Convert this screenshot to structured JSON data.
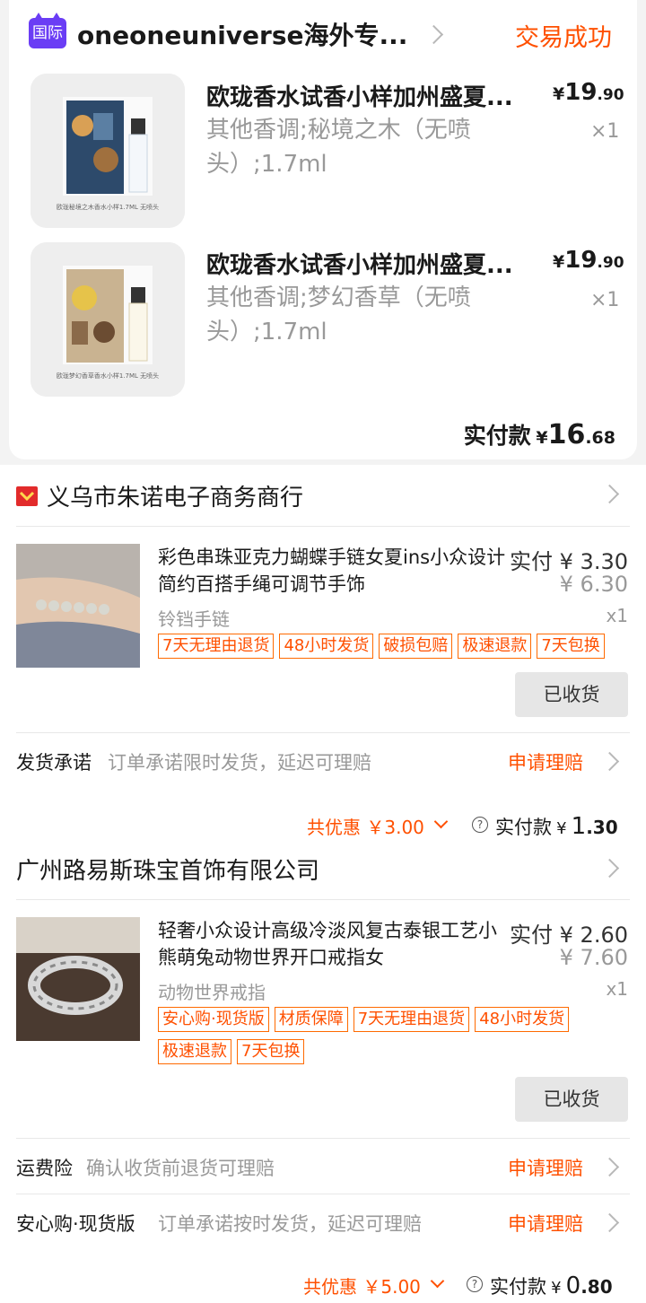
{
  "shop1": {
    "badge": "国际",
    "name": "oneoneuniverse海外专...",
    "status": "交易成功",
    "items": [
      {
        "title": "欧珑香水试香小样加州盛夏...",
        "sku": "其他香调;秘境之木（无喷头）;1.7ml",
        "price_int": "19",
        "price_dec": ".90",
        "currency": "¥",
        "qty": "×1",
        "caption": "欧珑秘境之木香水小样1.7ML 无喷头"
      },
      {
        "title": "欧珑香水试香小样加州盛夏...",
        "sku": "其他香调;梦幻香草（无喷头）;1.7ml",
        "price_int": "19",
        "price_dec": ".90",
        "currency": "¥",
        "qty": "×1",
        "caption": "欧珑梦幻香草香水小样1.7ML 无喷头"
      }
    ],
    "paid_label": "实付款",
    "paid_currency": "¥",
    "paid_int": "16",
    "paid_dec": ".68"
  },
  "shop2": {
    "name": "义乌市朱诺电子商务商行",
    "item": {
      "title": "彩色串珠亚克力蝴蝶手链女夏ins小众设计简约百搭手绳可调节手饰",
      "paid_label": "实付",
      "paid_price": "¥ 3.30",
      "orig_price": "¥ 6.30",
      "sku": "铃铛手链",
      "qty": "x1",
      "tags": [
        "7天无理由退货",
        "48小时发货",
        "破损包赔",
        "极速退款",
        "7天包换"
      ]
    },
    "button": "已收货",
    "service_label": "发货承诺",
    "service_desc": "订单承诺限时发货，延迟可理赔",
    "claim": "申请理赔",
    "discount": "共优惠 ￥3.00",
    "question": "?",
    "total_label": "实付款",
    "total_currency": "¥",
    "total_int": "1",
    "total_dec": ".30"
  },
  "shop3": {
    "name": "广州路易斯珠宝首饰有限公司",
    "item": {
      "title": "轻奢小众设计高级冷淡风复古泰银工艺小熊萌兔动物世界开口戒指女",
      "paid_label": "实付",
      "paid_price": "¥ 2.60",
      "orig_price": "¥ 7.60",
      "sku": "动物世界戒指",
      "qty": "x1",
      "tags": [
        "安心购·现货版",
        "材质保障",
        "7天无理由退货",
        "48小时发货",
        "极速退款",
        "7天包换"
      ]
    },
    "button": "已收货",
    "services": [
      {
        "label": "运费险",
        "desc": "确认收货前退货可理赔",
        "claim": "申请理赔"
      },
      {
        "label": "安心购·现货版",
        "desc": "订单承诺按时发货，延迟可理赔",
        "claim": "申请理赔"
      }
    ],
    "discount": "共优惠 ￥5.00",
    "question": "?",
    "total_label": "实付款",
    "total_currency": "¥",
    "total_int": "0",
    "total_dec": ".80"
  }
}
